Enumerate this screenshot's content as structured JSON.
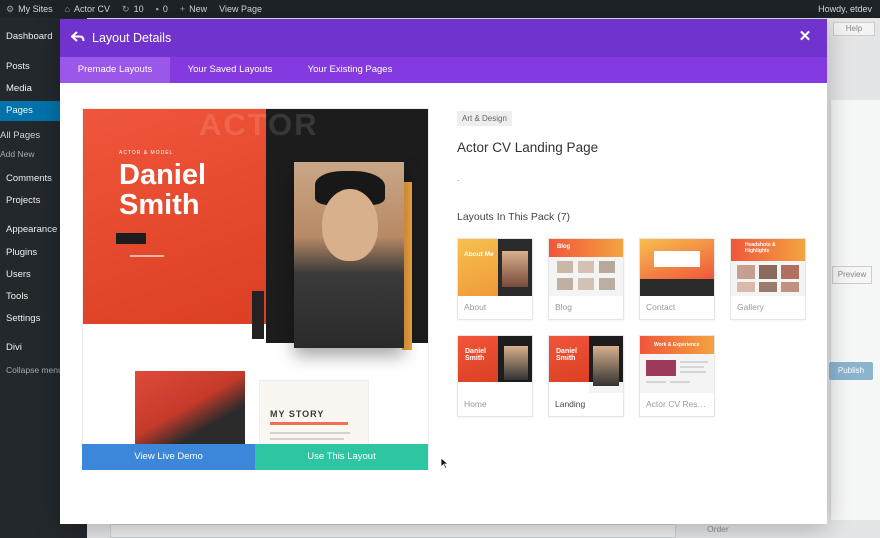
{
  "admin_bar": {
    "my_sites": "My Sites",
    "site_name": "Actor CV",
    "updates_count": "10",
    "comments_count": "0",
    "new_label": "New",
    "view_page": "View Page",
    "howdy": "Howdy, etdev"
  },
  "sidebar": {
    "items": [
      "Dashboard",
      "Posts",
      "Media",
      "Pages",
      "All Pages",
      "Add New",
      "Comments",
      "Projects",
      "Appearance",
      "Plugins",
      "Users",
      "Tools",
      "Settings",
      "Divi",
      "Collapse menu"
    ]
  },
  "background": {
    "help_label": "Help",
    "preview_label": "Preview",
    "publish_label": "Publish",
    "order_label": "Order"
  },
  "modal": {
    "title": "Layout Details",
    "tabs": [
      "Premade Layouts",
      "Your Saved Layouts",
      "Your Existing Pages"
    ],
    "active_tab": 0,
    "category": "Art & Design",
    "layout_title": "Actor CV Landing Page",
    "description": ".",
    "pack_heading": "Layouts In This Pack (7)",
    "view_demo": "View Live Demo",
    "use_layout": "Use This Layout",
    "layouts": [
      {
        "label": "About",
        "thumb_text": "About Me"
      },
      {
        "label": "Blog",
        "thumb_text": "Blog"
      },
      {
        "label": "Contact",
        "thumb_text": ""
      },
      {
        "label": "Gallery",
        "thumb_text": "Headshots & Highlights"
      },
      {
        "label": "Home",
        "thumb_text": "Daniel Smith"
      },
      {
        "label": "Landing",
        "thumb_text": "Daniel Smith"
      },
      {
        "label": "Actor CV Res…",
        "thumb_text": "Work & Experience"
      }
    ]
  },
  "preview": {
    "watermark": "ACTOR",
    "kicker": "ACTOR & MODEL",
    "first_name": "Daniel",
    "last_name": "Smith",
    "story_title": "MY STORY"
  },
  "colors": {
    "header": "#7033cd",
    "tabs": "#8539e0",
    "demo_button": "#3d87db",
    "use_button": "#2ec6a2",
    "accent_red": "#e04a2e"
  }
}
